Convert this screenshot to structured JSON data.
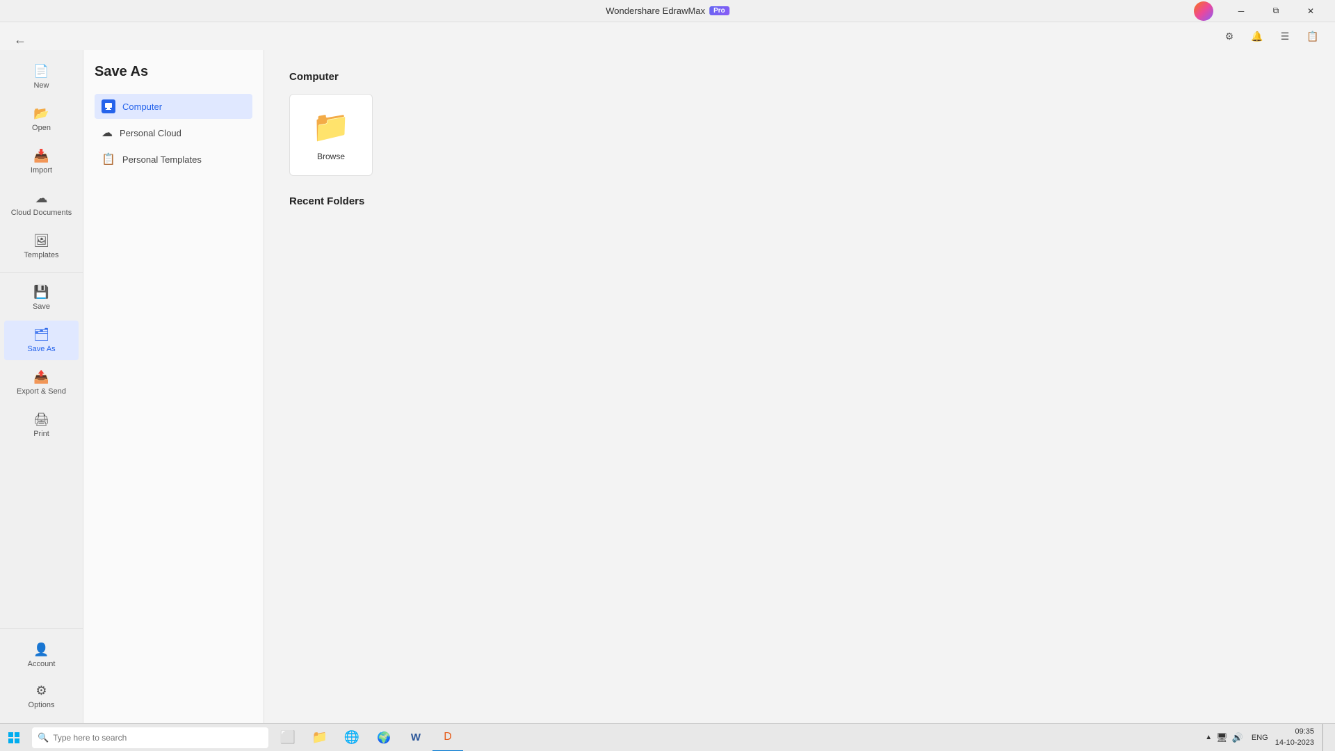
{
  "app": {
    "title": "Wondershare EdrawMax",
    "pro_badge": "Pro"
  },
  "title_bar": {
    "minimize_label": "─",
    "restore_label": "⧉",
    "close_label": "✕"
  },
  "toolbar": {
    "icons": [
      "⚙",
      "🔔",
      "☰",
      "📋"
    ]
  },
  "back_btn_label": "←",
  "sidebar_narrow": {
    "items": [
      {
        "id": "new",
        "label": "New",
        "icon": "📄",
        "active": false
      },
      {
        "id": "open",
        "label": "Open",
        "icon": "📂",
        "active": false
      },
      {
        "id": "import",
        "label": "Import",
        "icon": "📥",
        "active": false
      },
      {
        "id": "cloud",
        "label": "Cloud Documents",
        "icon": "☁",
        "active": false
      },
      {
        "id": "templates",
        "label": "Templates",
        "icon": "🖼",
        "active": false
      },
      {
        "id": "save",
        "label": "Save",
        "icon": "💾",
        "active": false
      },
      {
        "id": "saveas",
        "label": "Save As",
        "icon": "🗂",
        "active": true
      },
      {
        "id": "export",
        "label": "Export & Send",
        "icon": "📤",
        "active": false
      },
      {
        "id": "print",
        "label": "Print",
        "icon": "🖨",
        "active": false
      }
    ],
    "bottom_items": [
      {
        "id": "account",
        "label": "Account",
        "icon": "👤"
      },
      {
        "id": "options",
        "label": "Options",
        "icon": "⚙"
      }
    ]
  },
  "sidebar_mid": {
    "title": "Save As",
    "items": [
      {
        "id": "computer",
        "label": "Computer",
        "active": true
      },
      {
        "id": "personal_cloud",
        "label": "Personal Cloud",
        "active": false
      },
      {
        "id": "personal_templates",
        "label": "Personal Templates",
        "active": false
      }
    ]
  },
  "main": {
    "section_title": "Computer",
    "browse_label": "Browse",
    "recent_folders_title": "Recent Folders"
  },
  "taskbar": {
    "search_placeholder": "Type here to search",
    "apps": [
      {
        "id": "windows",
        "icon": "⊞"
      },
      {
        "id": "search",
        "icon": "🔍"
      },
      {
        "id": "taskview",
        "icon": "⬜"
      },
      {
        "id": "explorer",
        "icon": "📁"
      },
      {
        "id": "edge",
        "icon": "🌐"
      },
      {
        "id": "chrome",
        "icon": "⬤"
      },
      {
        "id": "word",
        "icon": "W"
      },
      {
        "id": "edrawmax",
        "icon": "D"
      }
    ],
    "tray": {
      "time": "09:35",
      "date": "14-10-2023",
      "lang": "ENG"
    }
  }
}
